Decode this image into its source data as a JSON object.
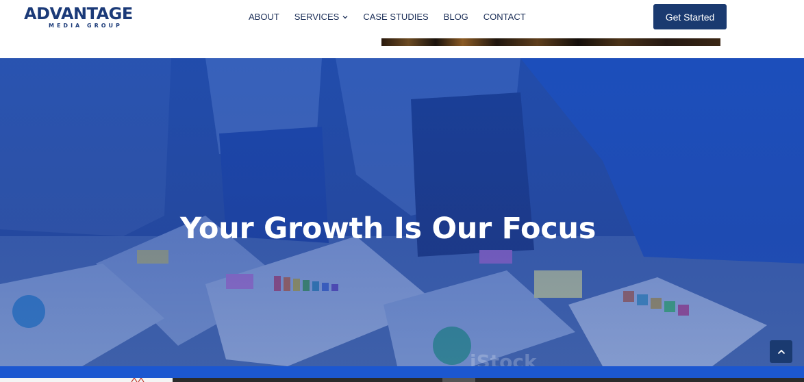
{
  "header": {
    "logo": {
      "name": "ADVANTAGE",
      "tagline": "MEDIA GROUP"
    },
    "nav": [
      {
        "label": "ABOUT"
      },
      {
        "label": "SERVICES",
        "icon": "chevron-down-icon"
      },
      {
        "label": "CASE STUDIES"
      },
      {
        "label": "BLOG"
      },
      {
        "label": "CONTACT"
      }
    ],
    "cta_label": "Get Started"
  },
  "hero": {
    "title": "Your Growth Is Our Focus",
    "watermark": "iStock"
  },
  "scroll_top": {
    "icon": "chevron-up-icon"
  },
  "colors": {
    "brand_navy": "#1a3a70",
    "nav_text": "#1c2f58",
    "hero_overlay_blue": "#1a4ebe",
    "bottom_band": "#1c57d0"
  }
}
